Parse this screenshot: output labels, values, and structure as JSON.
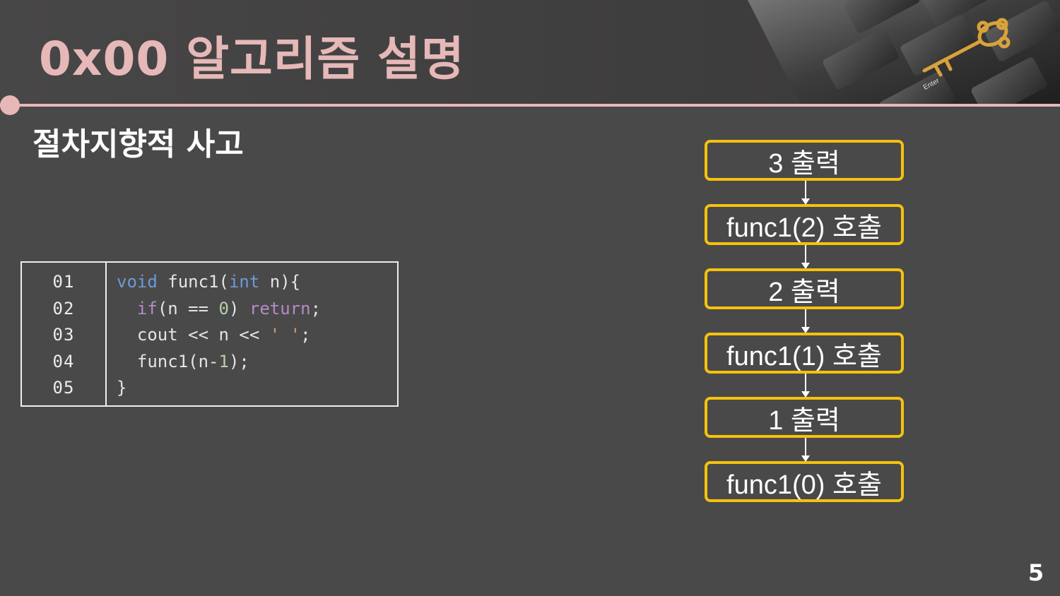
{
  "slide": {
    "title": "0x00  알고리즘 설명",
    "section_title": "절차지향적 사고",
    "page_number": "5"
  },
  "corner_image": {
    "key_label": "Enter"
  },
  "code": {
    "line_numbers": [
      "01",
      "02",
      "03",
      "04",
      "05"
    ],
    "lines": [
      [
        {
          "t": "type",
          "v": "void"
        },
        {
          "t": "plain",
          "v": " func1("
        },
        {
          "t": "type",
          "v": "int"
        },
        {
          "t": "plain",
          "v": " n){"
        }
      ],
      [
        {
          "t": "plain",
          "v": "  "
        },
        {
          "t": "kw",
          "v": "if"
        },
        {
          "t": "plain",
          "v": "(n == "
        },
        {
          "t": "num",
          "v": "0"
        },
        {
          "t": "plain",
          "v": ") "
        },
        {
          "t": "kw",
          "v": "return"
        },
        {
          "t": "plain",
          "v": ";"
        }
      ],
      [
        {
          "t": "plain",
          "v": "  cout << n << "
        },
        {
          "t": "str",
          "v": "' '"
        },
        {
          "t": "plain",
          "v": ";"
        }
      ],
      [
        {
          "t": "plain",
          "v": "  func1(n-"
        },
        {
          "t": "num",
          "v": "1"
        },
        {
          "t": "plain",
          "v": ");"
        }
      ],
      [
        {
          "t": "plain",
          "v": "}"
        }
      ]
    ],
    "colors": {
      "type": "#6a9bd6",
      "keyword": "#b48ac9",
      "number": "#b6cea8",
      "string": "#d49a7a"
    }
  },
  "flowchart": {
    "steps": [
      "3 출력",
      "func1(2) 호출",
      "2 출력",
      "func1(1) 호출",
      "1 출력",
      "func1(0) 호출"
    ],
    "border_color": "#f4c20d"
  },
  "theme": {
    "accent": "#e6b8b8",
    "background": "#4a4949"
  }
}
